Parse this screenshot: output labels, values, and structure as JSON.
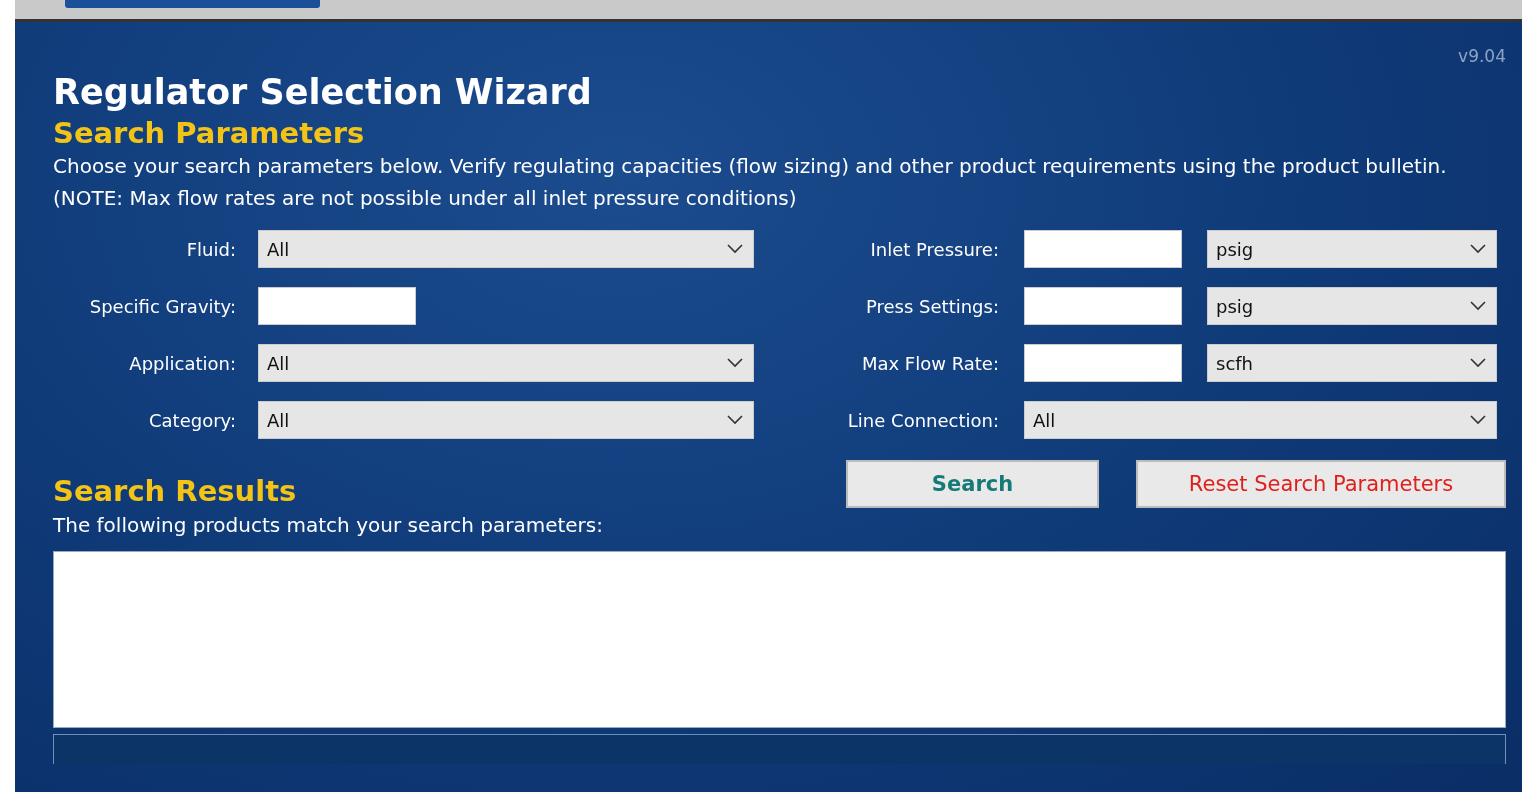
{
  "header": {
    "version": "v9.04",
    "title": "Regulator Selection Wizard"
  },
  "search_parameters": {
    "heading": "Search Parameters",
    "description": "Choose your search parameters below. Verify regulating capacities (flow sizing) and other product requirements using the product bulletin. (NOTE: Max flow rates are not possible under all inlet pressure conditions)",
    "fields_left": [
      {
        "kind": "select",
        "label": "Fluid:",
        "value": "All"
      },
      {
        "kind": "input",
        "label": "Specific Gravity:"
      },
      {
        "kind": "select",
        "label": "Application:",
        "value": "All"
      },
      {
        "kind": "select",
        "label": "Category:",
        "value": "All"
      }
    ],
    "fields_right": [
      {
        "kind": "input_unit",
        "label": "Inlet Pressure:",
        "unit": "psig"
      },
      {
        "kind": "input_unit",
        "label": "Press Settings:",
        "unit": "psig"
      },
      {
        "kind": "input_unit",
        "label": "Max Flow Rate:",
        "unit": "scfh"
      },
      {
        "kind": "select",
        "label": "Line Connection:",
        "value": "All"
      }
    ]
  },
  "buttons": [
    {
      "kind": "search",
      "label": "Search"
    },
    {
      "kind": "reset",
      "label": "Reset Search Parameters"
    }
  ],
  "search_results": {
    "heading": "Search Results",
    "description": "The following products match your search parameters:"
  }
}
